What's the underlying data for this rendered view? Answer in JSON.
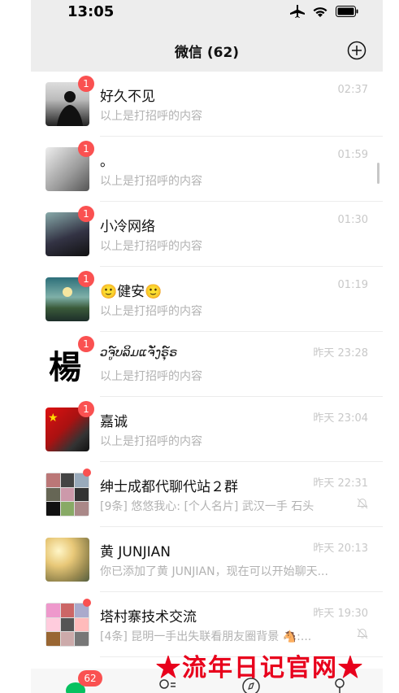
{
  "status_bar": {
    "time": "13:05"
  },
  "header": {
    "title": "微信 (62)"
  },
  "chats": [
    {
      "name": "好久不见",
      "message": "以上是打招呼的内容",
      "time": "02:37",
      "badge": "1"
    },
    {
      "name": "。",
      "message": "以上是打招呼的内容",
      "time": "01:59",
      "badge": "1"
    },
    {
      "name": "小冷网络",
      "message": "以上是打招呼的内容",
      "time": "01:30",
      "badge": "1"
    },
    {
      "name": "🙂健安🙂",
      "message": "以上是打招呼的内容",
      "time": "01:19",
      "badge": "1"
    },
    {
      "name": "ວຈູ໌ບລິມແຈັ່ງຣຸ໌ຣ",
      "message": "以上是打招呼的内容",
      "time": "昨天 23:28",
      "badge": "1"
    },
    {
      "name": "嘉诚",
      "message": "以上是打招呼的内容",
      "time": "昨天 23:04",
      "badge": "1"
    },
    {
      "name": "绅士成都代聊代站２群",
      "message": "[9条] 悠悠我心: [个人名片] 武汉一手  石头",
      "time": "昨天 22:31",
      "badge": "",
      "muted": true
    },
    {
      "name": "黄 JUNJIAN",
      "message": "你已添加了黄 JUNJIAN，现在可以开始聊天...",
      "time": "昨天 20:13",
      "badge": ""
    },
    {
      "name": "塔村寨技术交流",
      "message": "[4条] 昆明一手出失联看朋友圈背景 🐴:...",
      "time": "昨天 19:30",
      "badge": "",
      "muted": true
    }
  ],
  "tabbar": {
    "badge": "62"
  },
  "watermark": "★流年日记官网★",
  "colors": {
    "badge": "#fa5151",
    "background": "#ededed",
    "watermark": "#e8001c"
  }
}
